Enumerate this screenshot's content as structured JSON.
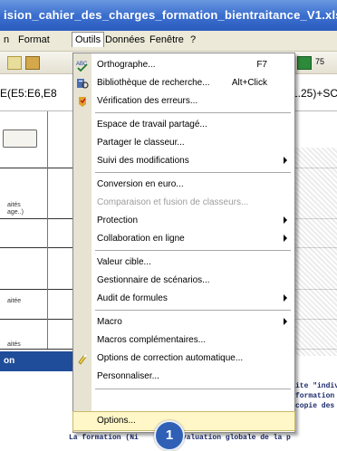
{
  "window": {
    "title": "ision_cahier_des_charges_formation_bientraitance_V1.xls"
  },
  "menubar": {
    "items": [
      {
        "label": "n",
        "active": false
      },
      {
        "label": "Format",
        "active": false
      },
      {
        "label": "Outils",
        "active": true
      },
      {
        "label": "Données",
        "active": false
      },
      {
        "label": "Fenêtre",
        "active": false
      },
      {
        "label": "?",
        "active": false
      }
    ]
  },
  "toolbar": {
    "right_text": "75"
  },
  "formula_bar": {
    "left_text": "E(E5:E6,E8",
    "right_text": "1.25)+SC"
  },
  "sheet": {
    "left_labels": [
      "aités",
      "age..)",
      "aitée",
      "aités"
    ],
    "blue_band": "on",
    "notes": [
      "ite \"indivi",
      "formation",
      "copie des"
    ],
    "bottom_note": "La formation (Ni      ne évaluation globale de la p"
  },
  "menu": {
    "items": [
      {
        "label": "Orthographe...",
        "shortcut": "F7",
        "icon": "spellcheck-icon",
        "submenu": false,
        "disabled": false
      },
      {
        "label": "Bibliothèque de recherche...",
        "shortcut": "Alt+Click",
        "icon": "research-library-icon",
        "submenu": false,
        "disabled": false
      },
      {
        "label": "Vérification des erreurs...",
        "shortcut": "",
        "icon": "error-check-icon",
        "submenu": false,
        "disabled": false
      },
      {
        "separator": true
      },
      {
        "label": "Espace de travail partagé...",
        "shortcut": "",
        "icon": "",
        "submenu": false,
        "disabled": false
      },
      {
        "label": "Partager le classeur...",
        "shortcut": "",
        "icon": "",
        "submenu": false,
        "disabled": false
      },
      {
        "label": "Suivi des modifications",
        "shortcut": "",
        "icon": "",
        "submenu": true,
        "disabled": false
      },
      {
        "separator": true
      },
      {
        "label": "Conversion en euro...",
        "shortcut": "",
        "icon": "",
        "submenu": false,
        "disabled": false
      },
      {
        "label": "Comparaison et fusion de classeurs...",
        "shortcut": "",
        "icon": "",
        "submenu": false,
        "disabled": true
      },
      {
        "label": "Protection",
        "shortcut": "",
        "icon": "",
        "submenu": true,
        "disabled": false
      },
      {
        "label": "Collaboration en ligne",
        "shortcut": "",
        "icon": "",
        "submenu": true,
        "disabled": false
      },
      {
        "separator": true
      },
      {
        "label": "Valeur cible...",
        "shortcut": "",
        "icon": "",
        "submenu": false,
        "disabled": false
      },
      {
        "label": "Gestionnaire de scénarios...",
        "shortcut": "",
        "icon": "",
        "submenu": false,
        "disabled": false
      },
      {
        "label": "Audit de formules",
        "shortcut": "",
        "icon": "",
        "submenu": true,
        "disabled": false
      },
      {
        "separator": true
      },
      {
        "label": "Macro",
        "shortcut": "",
        "icon": "",
        "submenu": true,
        "disabled": false
      },
      {
        "label": "Macros complémentaires...",
        "shortcut": "",
        "icon": "",
        "submenu": false,
        "disabled": false
      },
      {
        "label": "Options de correction automatique...",
        "shortcut": "",
        "icon": "autocorrect-icon",
        "submenu": false,
        "disabled": false
      },
      {
        "label": "Personnaliser...",
        "shortcut": "",
        "icon": "",
        "submenu": false,
        "disabled": false
      },
      {
        "separator": true
      },
      {
        "label": "Options...",
        "shortcut": "",
        "icon": "",
        "submenu": false,
        "disabled": false,
        "highlighted": true
      }
    ]
  },
  "step_badge": "1"
}
